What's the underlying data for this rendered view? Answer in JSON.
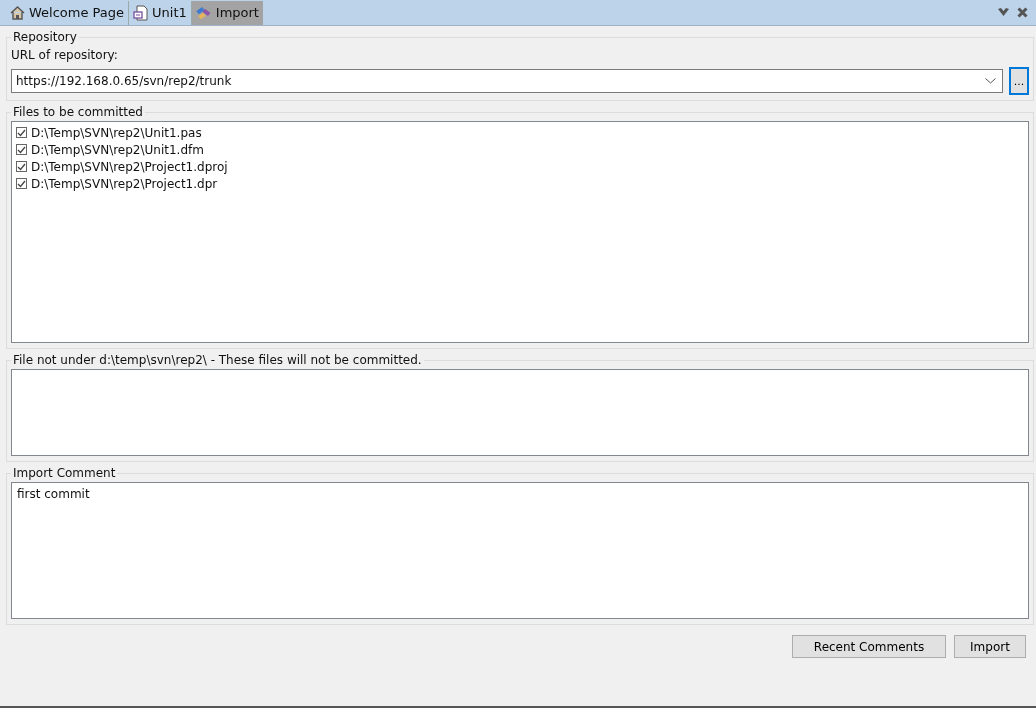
{
  "tabs": [
    {
      "label": "Welcome Page",
      "kind": "home",
      "selected": false
    },
    {
      "label": "Unit1",
      "kind": "unit",
      "selected": false
    },
    {
      "label": "Import",
      "kind": "import",
      "selected": true
    }
  ],
  "repository": {
    "title": "Repository",
    "url_label": "URL of repository:",
    "url": "https://192.168.0.65/svn/rep2/trunk",
    "browse_button": "..."
  },
  "files_group": {
    "title": "Files to be committed",
    "files": [
      {
        "path": "D:\\Temp\\SVN\\rep2\\Unit1.pas",
        "checked": true
      },
      {
        "path": "D:\\Temp\\SVN\\rep2\\Unit1.dfm",
        "checked": true
      },
      {
        "path": "D:\\Temp\\SVN\\rep2\\Project1.dproj",
        "checked": true
      },
      {
        "path": "D:\\Temp\\SVN\\rep2\\Project1.dpr",
        "checked": true
      }
    ]
  },
  "excluded_group": {
    "title": "File not under d:\\temp\\svn\\rep2\\ - These files will not be committed."
  },
  "comment_group": {
    "title": "Import Comment",
    "comment": "first commit"
  },
  "buttons": [
    "Recent Comments",
    "Import"
  ]
}
